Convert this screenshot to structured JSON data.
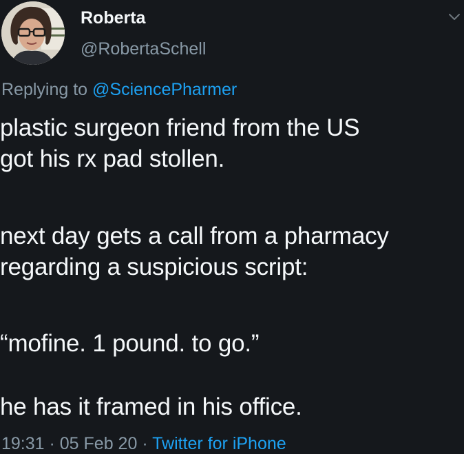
{
  "user": {
    "name": "Roberta",
    "handle": "@RobertaSchell"
  },
  "reply": {
    "prefix": "Replying to ",
    "mention": "@SciencePharmer"
  },
  "tweet": {
    "lines": [
      "plastic surgeon friend from the US",
      "got his rx pad stollen.",
      "next day gets a call from a pharmacy",
      "regarding a suspicious script:",
      "“mofine.  1 pound.  to go.”",
      "he has it framed in his office."
    ]
  },
  "meta": {
    "time": "19:31",
    "sep1": " · ",
    "date": "05 Feb 20",
    "sep2": " · ",
    "source": "Twitter for iPhone"
  },
  "colors": {
    "background": "#15181c",
    "text": "#f5f8fa",
    "secondary": "#8899a6",
    "link": "#1da1f2"
  },
  "icons": {
    "menu": "chevron-down-icon"
  }
}
